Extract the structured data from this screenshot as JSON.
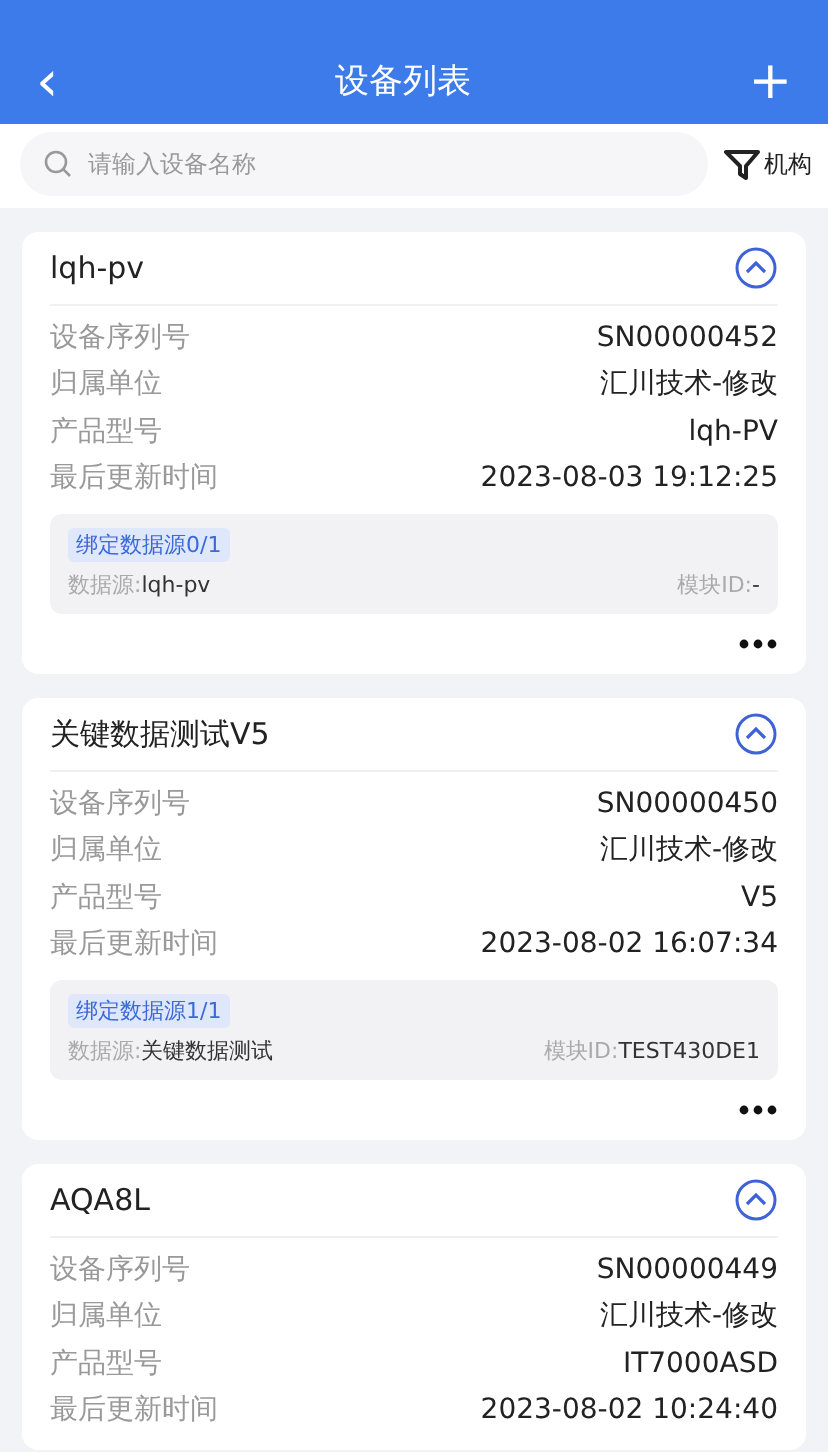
{
  "header": {
    "back": "‹",
    "title": "设备列表",
    "add": "+"
  },
  "search": {
    "placeholder": "请输入设备名称",
    "filter": "机构"
  },
  "devices": [
    {
      "name": "lqh-pv",
      "expanded": true,
      "fields": [
        {
          "label": "设备序列号",
          "value": "SN00000452"
        },
        {
          "label": "归属单位",
          "value": "汇川技术-修改"
        },
        {
          "label": "产品型号",
          "value": "lqh-PV"
        },
        {
          "label": "最后更新时间",
          "value": "2023-08-03 19:12:25"
        }
      ],
      "binding": {
        "tag": "绑定数据源0/1",
        "source_label": "数据源:",
        "source": "lqh-pv",
        "module_label": "模块ID:",
        "module": "-"
      }
    },
    {
      "name": "关键数据测试V5",
      "expanded": true,
      "fields": [
        {
          "label": "设备序列号",
          "value": "SN00000450"
        },
        {
          "label": "归属单位",
          "value": "汇川技术-修改"
        },
        {
          "label": "产品型号",
          "value": "V5"
        },
        {
          "label": "最后更新时间",
          "value": "2023-08-02 16:07:34"
        }
      ],
      "binding": {
        "tag": "绑定数据源1/1",
        "source_label": "数据源:",
        "source": "关键数据测试",
        "module_label": "模块ID:",
        "module": "TEST430DE1"
      }
    },
    {
      "name": "AQA8L",
      "expanded": true,
      "fields": [
        {
          "label": "设备序列号",
          "value": "SN00000449"
        },
        {
          "label": "归属单位",
          "value": "汇川技术-修改"
        },
        {
          "label": "产品型号",
          "value": "IT7000ASD"
        },
        {
          "label": "最后更新时间",
          "value": "2023-08-02 10:24:40"
        }
      ]
    }
  ]
}
